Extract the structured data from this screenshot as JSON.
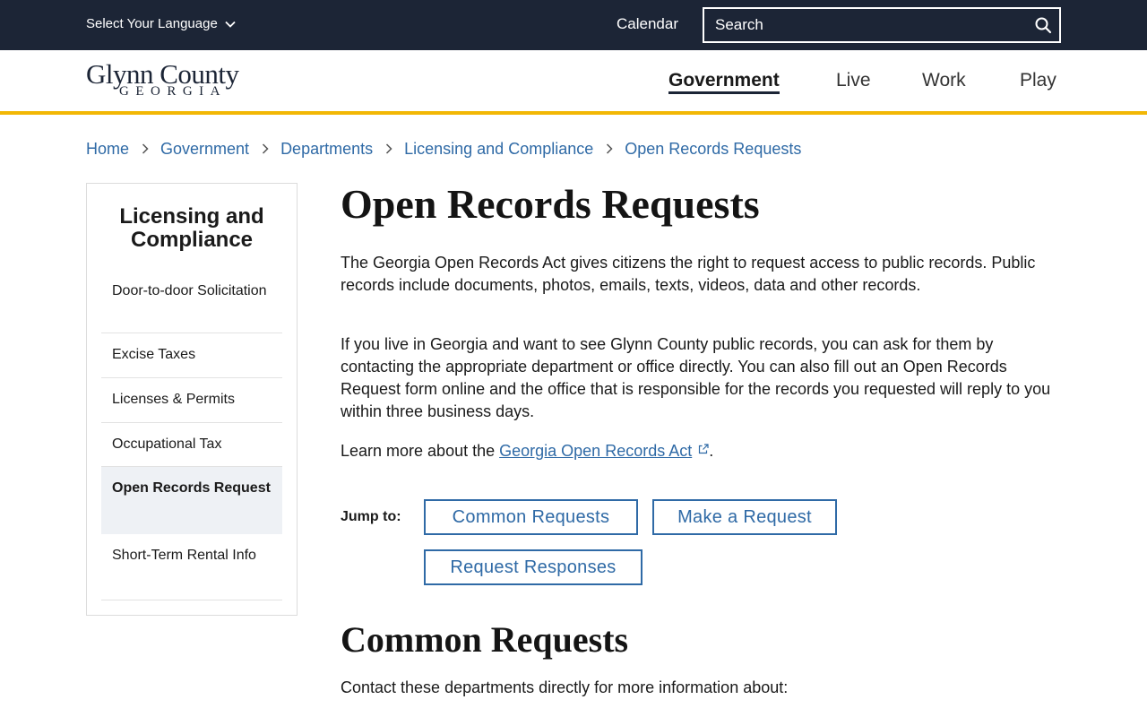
{
  "topbar": {
    "language_label": "Select Your Language",
    "calendar_label": "Calendar",
    "search_placeholder": "Search"
  },
  "header": {
    "logo_main": "Glynn County",
    "logo_sub": "GEORGIA",
    "nav": [
      {
        "label": "Government",
        "active": true
      },
      {
        "label": "Live"
      },
      {
        "label": "Work"
      },
      {
        "label": "Play"
      }
    ]
  },
  "breadcrumb": [
    "Home",
    "Government",
    "Departments",
    "Licensing and Compliance",
    "Open Records Requests"
  ],
  "sidebar": {
    "title": "Licensing and Compliance",
    "items": [
      {
        "label": "Door-to-door Solicitation"
      },
      {
        "label": "Excise Taxes"
      },
      {
        "label": "Licenses & Permits"
      },
      {
        "label": "Occupational Tax"
      },
      {
        "label": "Open Records Request",
        "active": true
      },
      {
        "label": "Short-Term Rental Info"
      }
    ]
  },
  "main": {
    "title": "Open Records Requests",
    "intro_1": "The Georgia Open Records Act gives citizens the right to request access to public records. Public records include documents, photos, emails, texts, videos, data and other records.",
    "intro_2": "If you live in Georgia and want to see Glynn County public records, you can ask for them by contacting the appropriate department or office directly. You can also fill out an Open Records Request form online and the office that is responsible for the records you requested will reply to you within three business days.",
    "learn_prefix": "Learn more about the ",
    "learn_link": "Georgia Open Records Act",
    "learn_suffix": ".",
    "jump_label": "Jump to:",
    "jump_links": [
      "Common Requests",
      "Make a Request",
      "Request Responses"
    ],
    "section_title": "Common Requests",
    "section_intro": "Contact these departments directly for more information about:"
  },
  "colors": {
    "topbar_bg": "#1c2536",
    "accent_gold": "#f2b705",
    "link_blue": "#2f6aa6"
  }
}
